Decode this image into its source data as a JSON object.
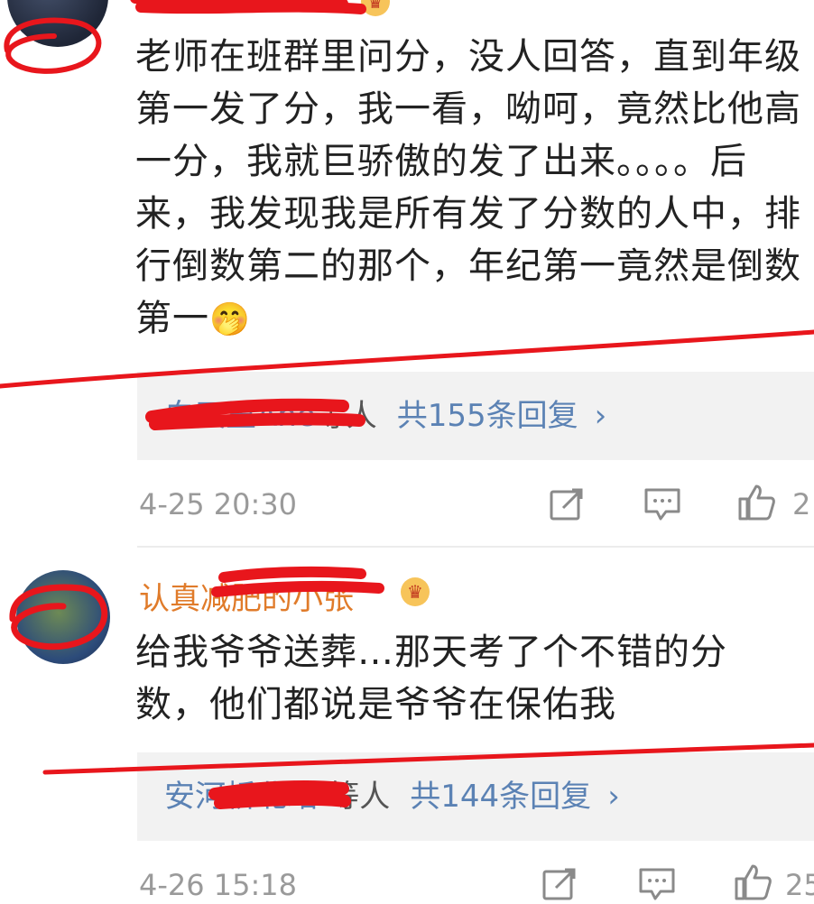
{
  "comments": [
    {
      "username": "",
      "text": "老师在班群里问分，没人回答，直到年级第一发了分，我一看，呦呵，竟然比他高一分，我就巨骄傲的发了出来。。。。后来，我发现我是所有发了分数的人中，排行倒数第二的那个，年纪第一竟然是倒数第一",
      "emoji": "🤭",
      "replies": {
        "names": "白天里Ane",
        "suffix": "等人",
        "count": "共155条回复",
        "chevron": "›"
      },
      "time": "4-25 20:30",
      "likes": "2"
    },
    {
      "username": "认真减肥的小张",
      "text": "给我爷爷送葬…那天考了个不错的分数，他们都说是爷爷在保佑我",
      "replies": {
        "names": "安河桥北站",
        "suffix": "-等人",
        "count": "共144条回复",
        "chevron": "›"
      },
      "time": "4-26 15:18",
      "likes": "25"
    }
  ],
  "icons": [
    "share-icon",
    "comment-icon",
    "like-icon",
    "crown-badge-icon"
  ],
  "colors": {
    "username": "#e07b2a",
    "link": "#5b82b4",
    "meta": "#9a9a9a",
    "annotation": "#e8161c",
    "reply_bg": "#f2f2f2"
  }
}
